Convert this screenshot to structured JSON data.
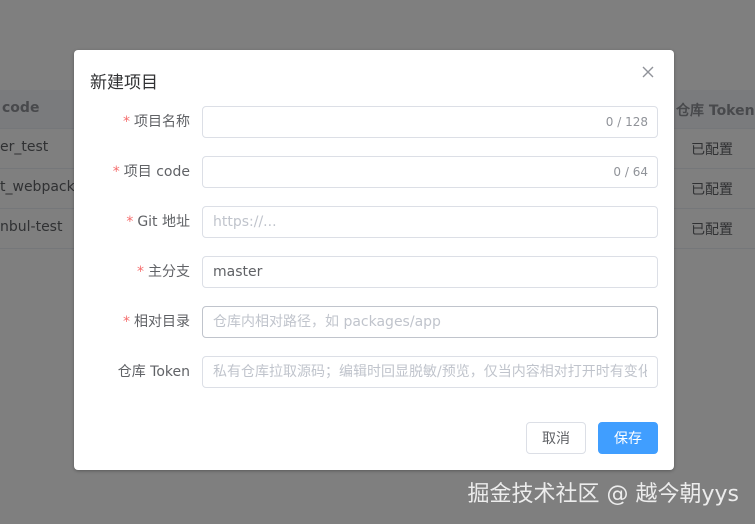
{
  "background_table": {
    "headers": {
      "code": "code",
      "token": "仓库 Token"
    },
    "rows": [
      {
        "code": "er_test",
        "token": "已配置"
      },
      {
        "code": "t_webpack",
        "token": "已配置"
      },
      {
        "code": "nbul-test",
        "token": "已配置"
      }
    ]
  },
  "dialog": {
    "title": "新建项目",
    "fields": [
      {
        "label": "项目名称",
        "required": true,
        "value": "",
        "placeholder": "",
        "counter": "0 / 128"
      },
      {
        "label": "项目 code",
        "required": true,
        "value": "",
        "placeholder": "",
        "counter": "0 / 64"
      },
      {
        "label": "Git 地址",
        "required": true,
        "value": "",
        "placeholder": "https://...",
        "counter": ""
      },
      {
        "label": "主分支",
        "required": true,
        "value": "master",
        "placeholder": "",
        "counter": ""
      },
      {
        "label": "相对目录",
        "required": true,
        "value": "",
        "placeholder": "仓库内相对路径，如 packages/app",
        "counter": ""
      },
      {
        "label": "仓库 Token",
        "required": false,
        "value": "",
        "placeholder": "私有仓库拉取源码；编辑时回显脱敏/预览，仅当内容相对打开时有变化",
        "counter": ""
      }
    ],
    "required_mark": "*",
    "cancel_label": "取消",
    "save_label": "保存"
  },
  "watermark": "掘金技术社区 @ 越今朝yys",
  "colors": {
    "primary": "#409eff",
    "required": "#f56c6c",
    "overlay": "rgba(0,0,0,0.5)"
  }
}
